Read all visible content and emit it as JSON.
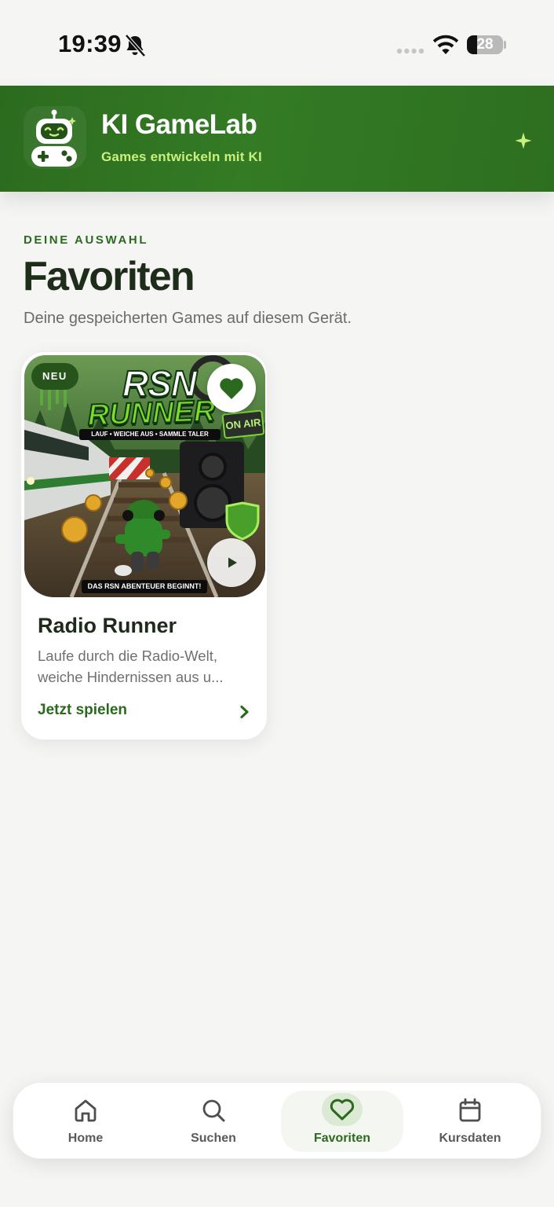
{
  "status_bar": {
    "time": "19:39",
    "battery": "28",
    "battery_level": 0.28
  },
  "header": {
    "title": "KI GameLab",
    "subtitle": "Games entwickeln mit KI",
    "logo_icon": "robot-gamepad-icon",
    "accent_icon": "sparkle-icon"
  },
  "page": {
    "eyebrow": "DEINE AUSWAHL",
    "title": "Favoriten",
    "description": "Deine gespeicherten Games auf diesem Gerät."
  },
  "games": [
    {
      "badge": "NEU",
      "title": "Radio Runner",
      "description_lines": [
        "Laufe durch die Radio-Welt,",
        "weiche Hindernissen aus u..."
      ],
      "cta": "Jetzt spielen",
      "favorited": true,
      "artwork": {
        "logo_top": "RSN",
        "logo_bottom": "RUNNER",
        "tagline": "LAUF • WEICHE AUS • SAMMLE TALER",
        "sign": "ON AIR",
        "banner": "DAS RSN ABENTEUER BEGINNT!"
      }
    }
  ],
  "tab_bar": {
    "tabs": [
      {
        "label": "Home",
        "icon": "home-icon",
        "active": false
      },
      {
        "label": "Suchen",
        "icon": "search-icon",
        "active": false
      },
      {
        "label": "Favoriten",
        "icon": "heart-icon",
        "active": true
      },
      {
        "label": "Kursdaten",
        "icon": "calendar-icon",
        "active": false
      }
    ]
  },
  "colors": {
    "brand_green": "#2c6b1f",
    "accent_lime": "#c9ef7e",
    "background": "#f5f5f4"
  }
}
